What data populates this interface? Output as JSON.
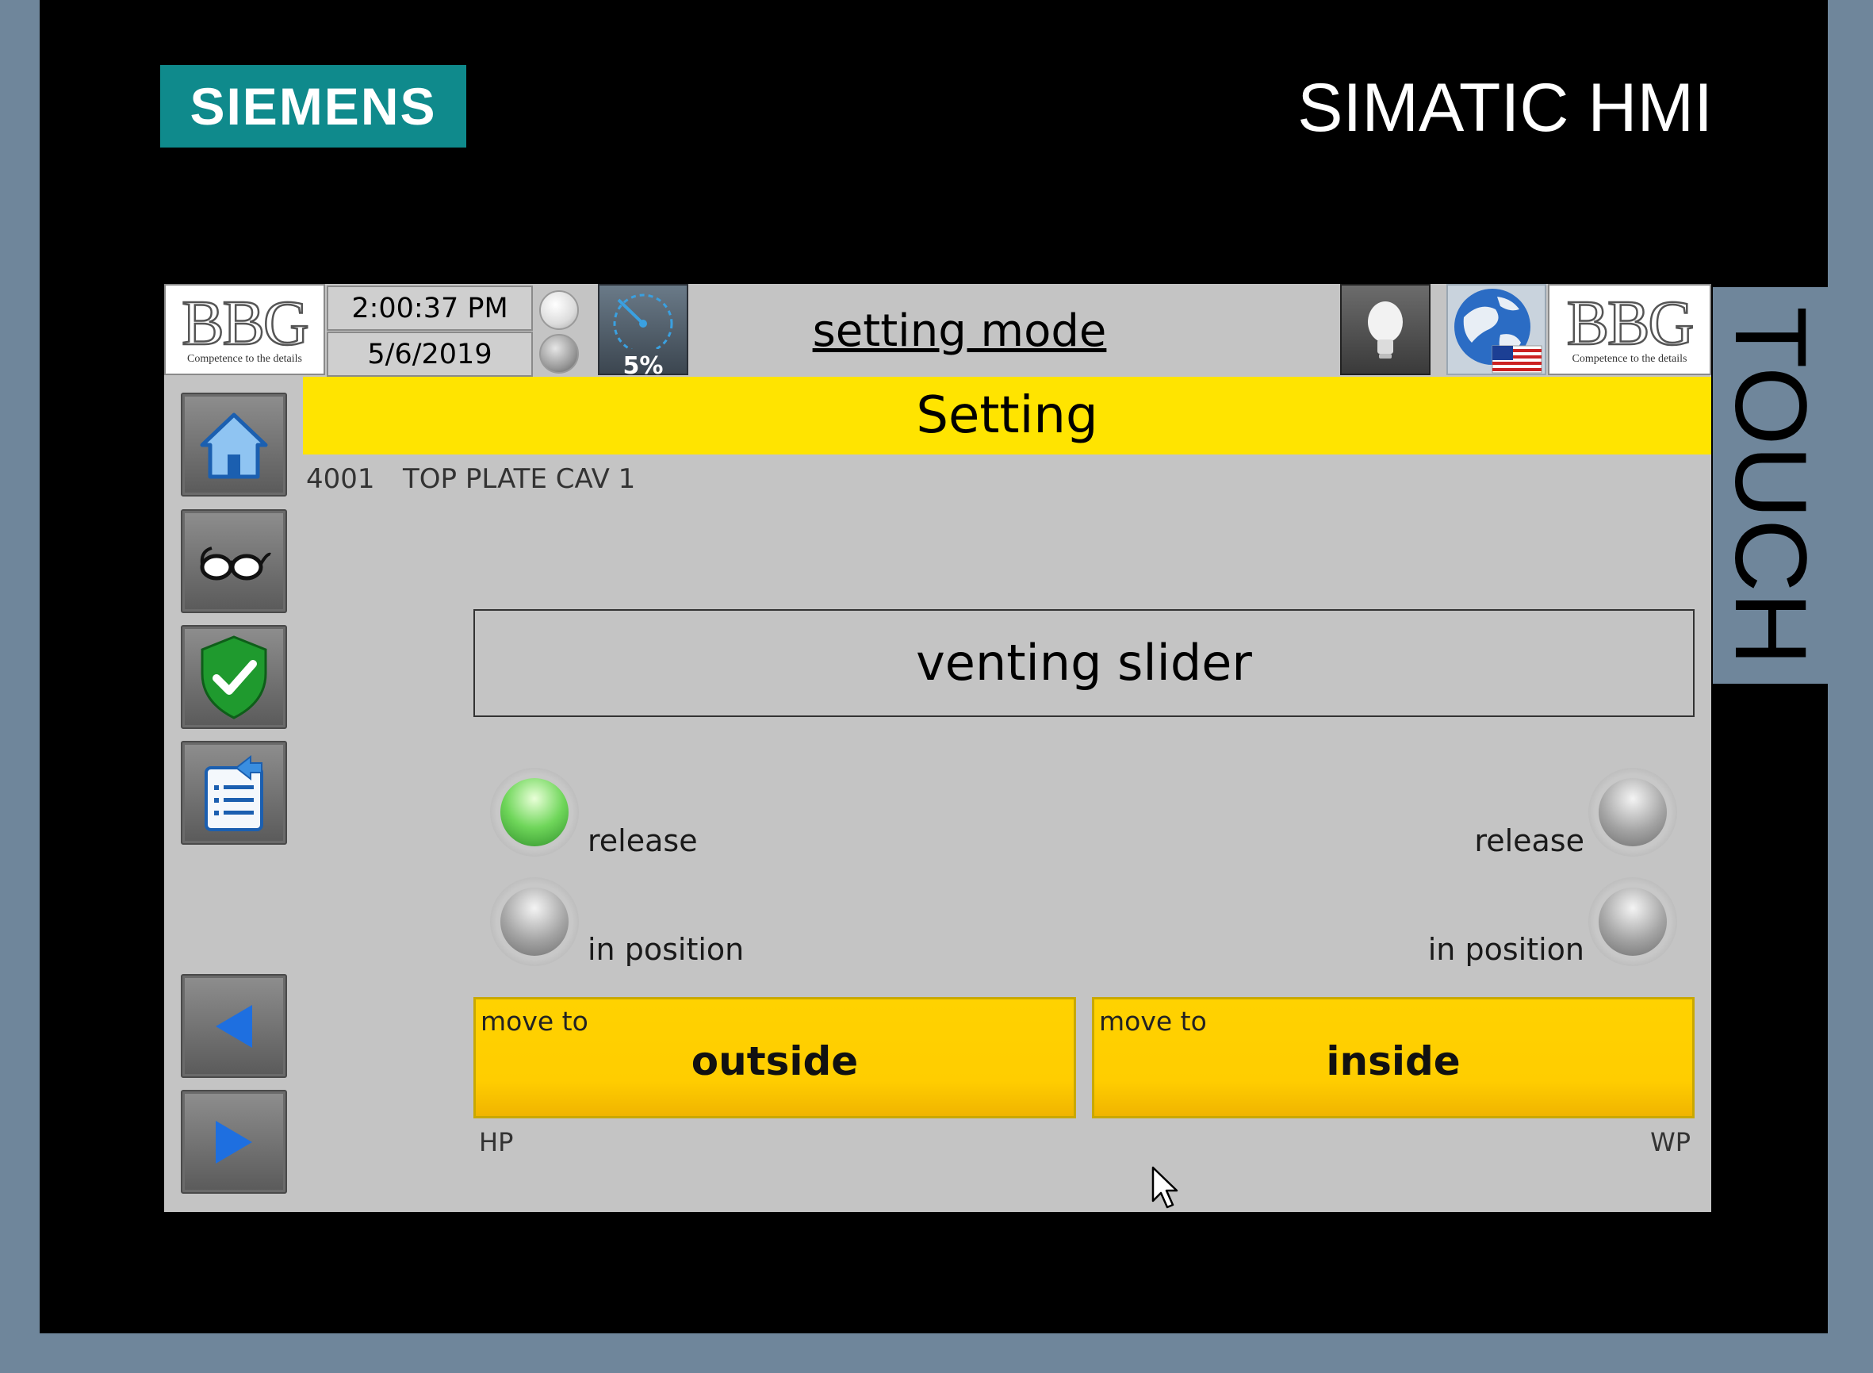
{
  "device": {
    "brand": "SIEMENS",
    "product": "SIMATIC HMI",
    "touch_label": "TOUCH"
  },
  "header": {
    "logo_left": {
      "mark": "BBG",
      "tagline": "Competence to the details"
    },
    "logo_right": {
      "mark": "BBG",
      "tagline": "Competence to the details"
    },
    "time": "2:00:37 PM",
    "date": "5/6/2019",
    "speed_percent": "5%",
    "mode": "setting mode"
  },
  "title_bar": {
    "title": "Setting"
  },
  "station": {
    "number": "4001",
    "name": "TOP PLATE CAV 1"
  },
  "panel": {
    "title": "venting slider",
    "left": {
      "release_label": "release",
      "release_on": true,
      "in_position_label": "in position",
      "in_position_on": false
    },
    "right": {
      "release_label": "release",
      "release_on": false,
      "in_position_label": "in position",
      "in_position_on": false
    },
    "buttons": {
      "outside": {
        "small": "move to",
        "big": "outside"
      },
      "inside": {
        "small": "move to",
        "big": "inside"
      }
    },
    "hp_label": "HP",
    "wp_label": "WP"
  },
  "colors": {
    "siemens_teal": "#0f8a8c",
    "title_yellow": "#ffe400",
    "button_yellow": "#ffcd00",
    "screen_gray": "#c4c4c4",
    "frame_blue_gray": "#6f869b"
  }
}
